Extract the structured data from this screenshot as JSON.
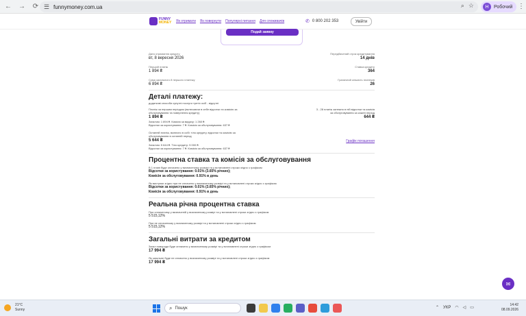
{
  "browser": {
    "url": "funnymoney.com.ua",
    "profile_initial": "Н",
    "profile_name": "Робочий"
  },
  "header": {
    "logo_line1": "FUNNY",
    "logo_line2": "MONEY",
    "nav": [
      "Як отримати",
      "Як повернути",
      "Популярні питання",
      "Для споживачів"
    ],
    "phone": "0 800 202 353",
    "login": "Увійти"
  },
  "apply": {
    "button": "Подай заявку"
  },
  "summary": {
    "date_label": "Дата отримання кредиту",
    "date_value": "вт, 8 вересня 2026",
    "term_label": "Передбачений строк кредитування",
    "term_value": "14 днів",
    "first_payment_label": "Перший платіж",
    "first_payment_value": "1 894 ₴",
    "apr_label": "Ставка кредиту",
    "apr_value": "364",
    "total_label": "Сума загального й першого платежу",
    "total_value": "6 894 ₴",
    "days_label": "Граничний кількість платежів",
    "days_value": "26"
  },
  "payment_details": {
    "title": "Деталі платежу:",
    "subtitle": "додаткові способи супутні послуги третіх осіб - відсутні",
    "p1_desc": "Платіж за першим періодом (включаючи в себе відсотки та комісію за обслуговування та повернення кредиту)",
    "p1_value": "1 894 ₴",
    "p1_line1": "Загалом: 1 894 ₴. Комісія за видачу: 1 260 ₴.",
    "p1_line2": "Відсотки за користування: 7 ₴. Комісія за обслуговування: 637 ₴",
    "right_desc": "3 - 28 платіж залежно в ній відсотки та комісія за обслуговування за кожен період",
    "right_value": "644 ₴",
    "p2_desc": "Останній платіж, включно в собі: тіло кредиту, відсотки та комісію за обслуговування в останній період",
    "p2_value": "5 644 ₴",
    "p2_line1": "Загалом: 5 644 ₴. Тіло кредиту: 5 000 ₴.",
    "p2_line2": "Відсотки за користування: 7 ₴. Комісія за обслуговування: 637 ₴",
    "schedule_link": "Графік погашення"
  },
  "rates": {
    "title": "Процентна ставка та комісія за обслуговування",
    "block1_note": "В 1 плані буде оплачено у визначеному розмірі та у встановлені строки згідно з графіком",
    "block1_line1": "Відсотки за користування: 0.01% (3.65% річних);",
    "block1_line2": "Комісія за обслуговування: 0.91% в день",
    "block2_note": "Як виступає згідно при не сплачено у визначеному розмірі та у встановлені строки згідно з графіком",
    "block2_line1": "Відсотки за користування: 0.01% (3.65% річних);",
    "block2_line2": "Комісія за обслуговування: 0.91% в день"
  },
  "real_rate": {
    "title": "Реальна річна процентна ставка",
    "note1": "При сплаченому у визначеній у визначеному розмірі та у встановлені строки згідно з графіком",
    "value1": "5 515,12%",
    "note2": "При не сплаченому у визначеному розмірі та у встановлені строки згідно з графіком",
    "value2": "5 515,12%"
  },
  "total_cost": {
    "title": "Загальні витрати за кредитом",
    "note1": "Загал повороди буде оплачено у визначеному розмірі та у встановлені строки згідно з графіком",
    "value1": "17 994 ₴",
    "note2": "Як загальне буде не сплачено у визначеному розмірі та у встановлені строки згідно з графіком",
    "value2": "17 994 ₴"
  },
  "taskbar": {
    "temp": "21°C",
    "weather": "Sunny",
    "search": "Пошук",
    "lang": "УКР",
    "time": "14:42",
    "date": "08.09.2026"
  }
}
